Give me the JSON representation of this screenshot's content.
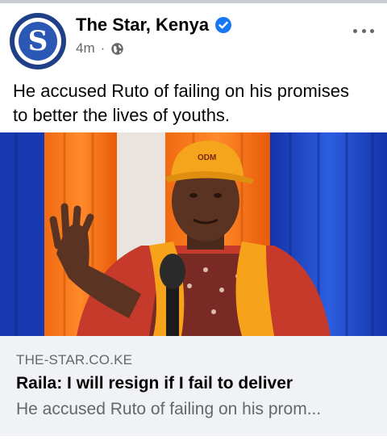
{
  "post": {
    "page_name": "The Star, Kenya",
    "avatar_letter": "S",
    "time": "4m",
    "separator": "·",
    "caption": "He accused Ruto of failing on his promises to better the lives of youths."
  },
  "photo": {
    "cap_text": "ODM"
  },
  "link_card": {
    "domain": "THE-STAR.CO.KE",
    "title": "Raila: I will resign if I fail to deliver",
    "description": "He accused Ruto of failing on his prom..."
  },
  "colors": {
    "brand_blue": "#1f3f87",
    "verified_blue": "#1877f2",
    "secondary_text": "#65676b",
    "card_background": "#f0f2f5"
  },
  "icons": [
    "verified-badge-icon",
    "globe-icon",
    "more-options-icon"
  ]
}
